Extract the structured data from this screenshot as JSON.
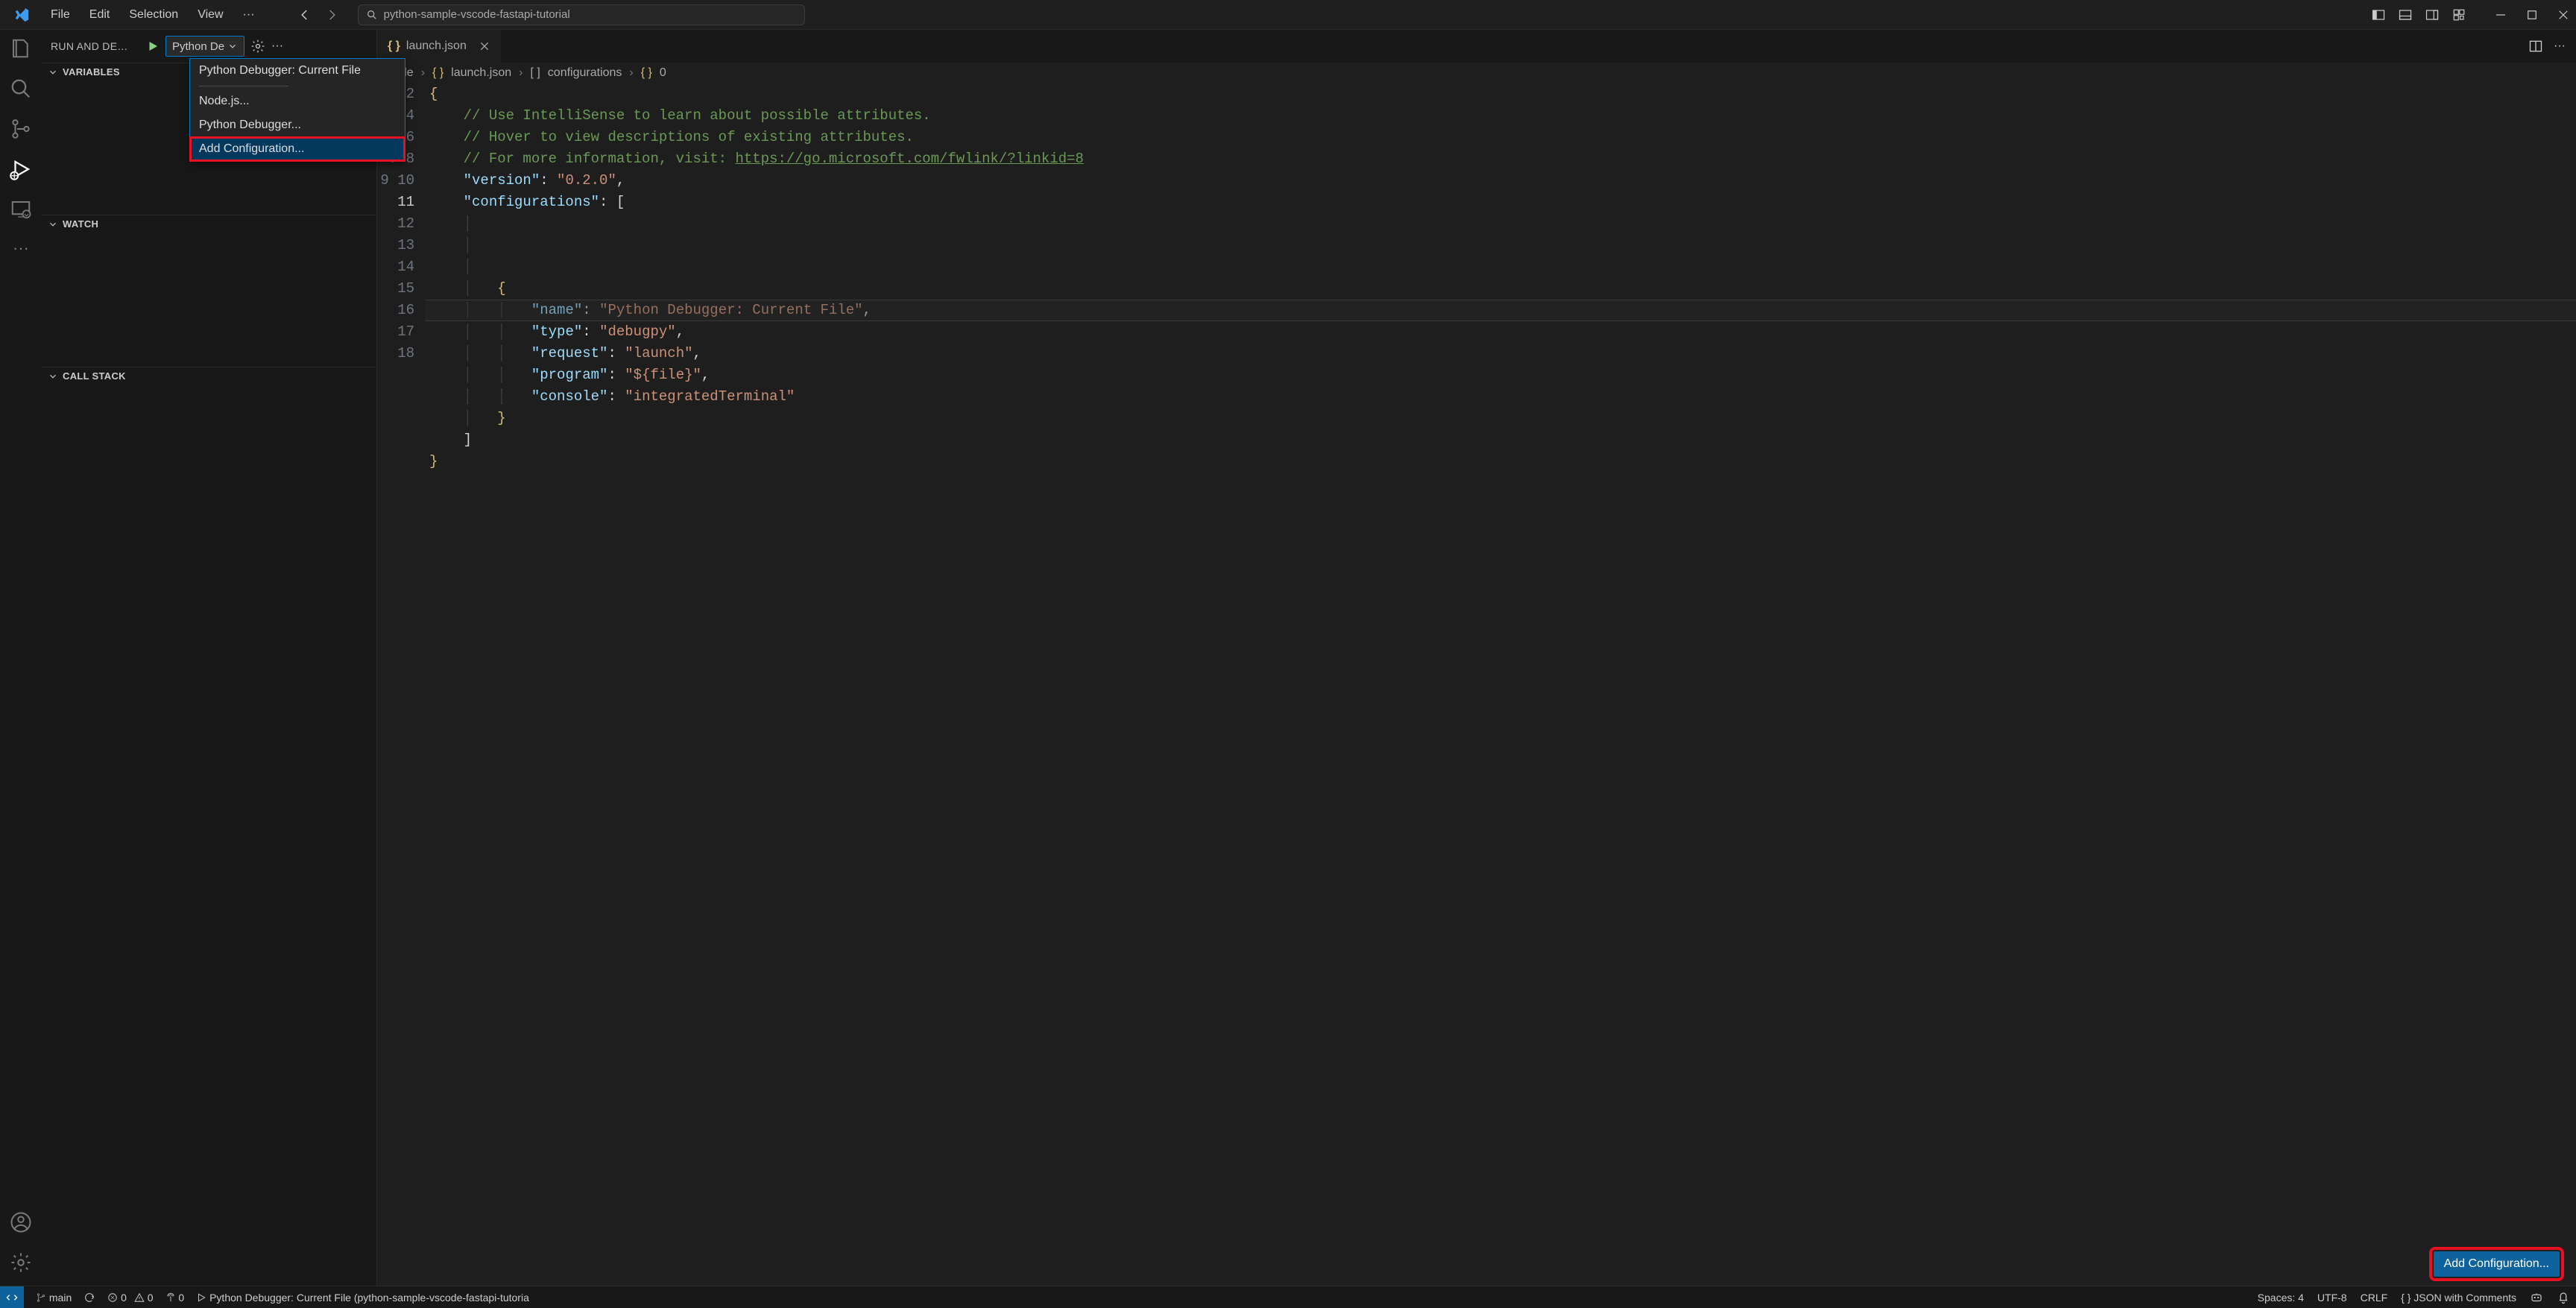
{
  "menubar": {
    "file": "File",
    "edit": "Edit",
    "selection": "Selection",
    "view": "View"
  },
  "search_placeholder": "python-sample-vscode-fastapi-tutorial",
  "sidebar": {
    "title": "RUN AND DE…",
    "config_selected": "Python De",
    "sections": {
      "variables": "Variables",
      "watch": "Watch",
      "callstack": "Call Stack"
    }
  },
  "dropdown": {
    "current": "Python Debugger: Current File",
    "node": "Node.js...",
    "py": "Python Debugger...",
    "add": "Add Configuration..."
  },
  "tab": {
    "filename": "launch.json"
  },
  "breadcrumb": {
    "folder": "code",
    "file": "launch.json",
    "arr": "configurations",
    "idx": "0"
  },
  "code": {
    "c1": "// Use IntelliSense to learn about possible attributes.",
    "c2": "// Hover to view descriptions of existing attributes.",
    "c3": "// For more information, visit: ",
    "link": "https://go.microsoft.com/fwlink/?linkid=8",
    "version_k": "\"version\"",
    "version_v": "\"0.2.0\"",
    "configs_k": "\"configurations\"",
    "name_k": "\"name\"",
    "name_v": "\"Python Debugger: Current File\"",
    "type_k": "\"type\"",
    "type_v": "\"debugpy\"",
    "request_k": "\"request\"",
    "request_v": "\"launch\"",
    "program_k": "\"program\"",
    "program_v": "\"${file}\"",
    "console_k": "\"console\"",
    "console_v": "\"integratedTerminal\""
  },
  "button": {
    "add_config": "Add Configuration..."
  },
  "status": {
    "branch": "main",
    "errors": "0",
    "warnings": "0",
    "ports": "0",
    "debugger": "Python Debugger: Current File (python-sample-vscode-fastapi-tutoria",
    "spaces": "Spaces: 4",
    "enc": "UTF-8",
    "eol": "CRLF",
    "lang": "JSON with Comments"
  }
}
